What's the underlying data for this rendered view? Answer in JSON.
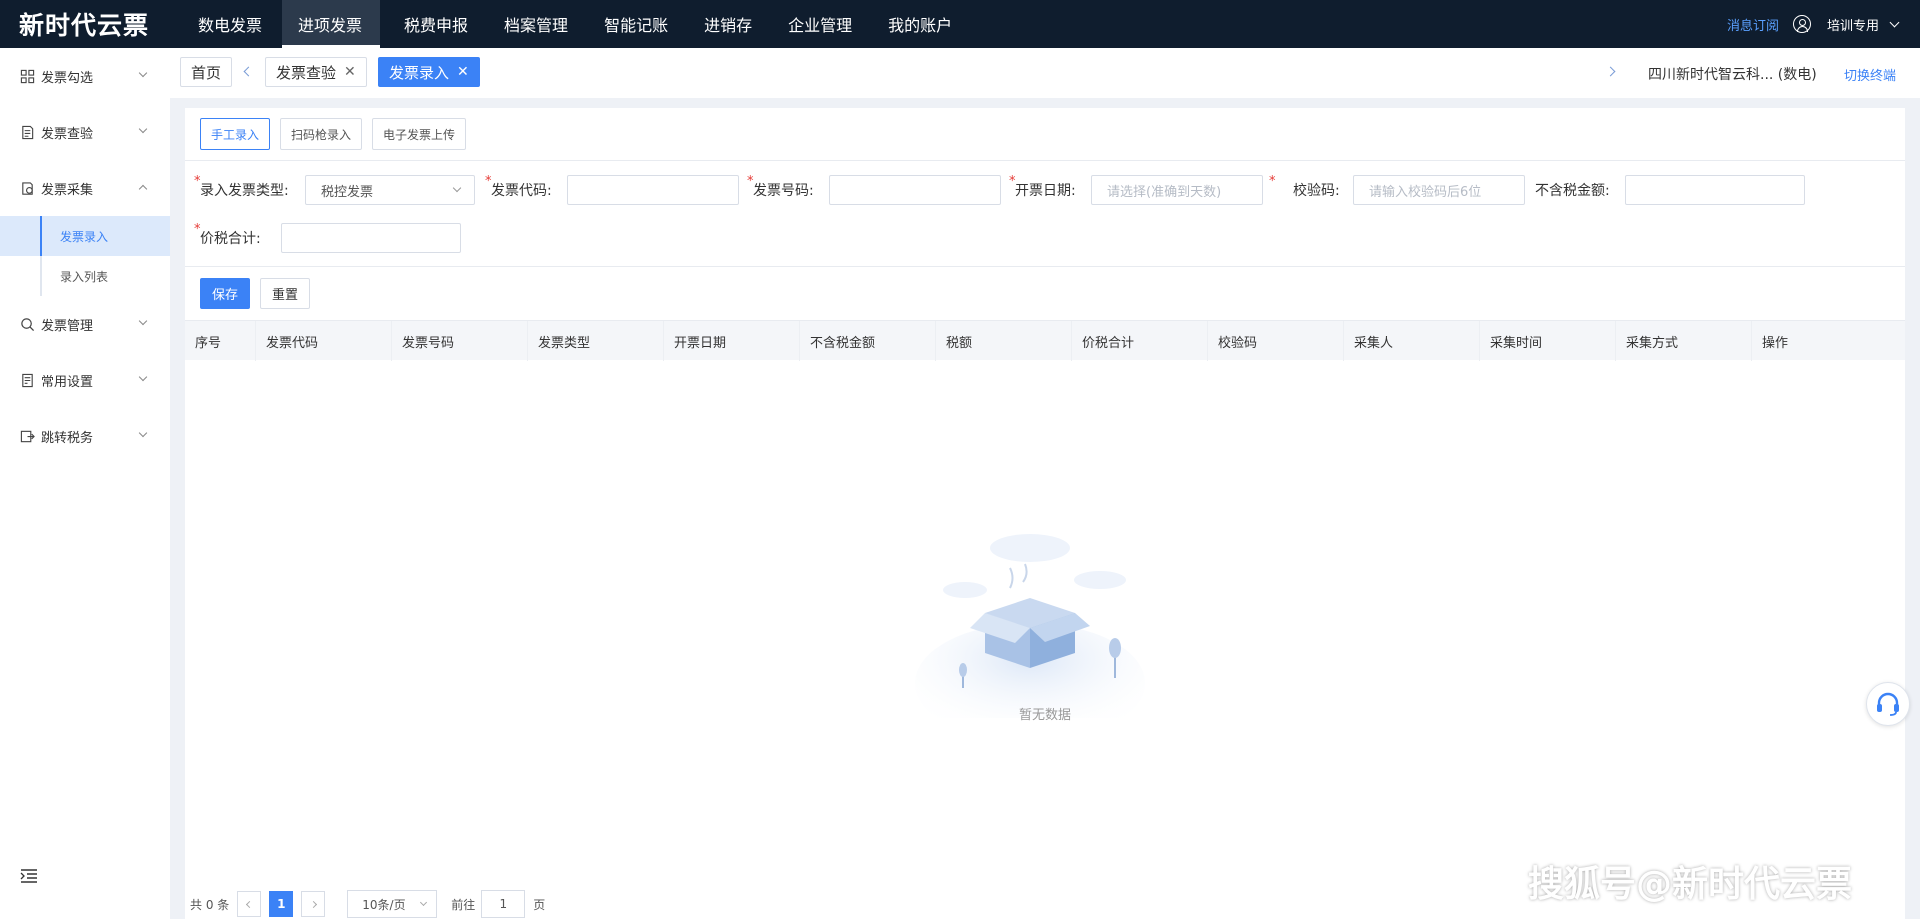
{
  "app": {
    "logo": "新时代云票",
    "nav": [
      "数电发票",
      "进项发票",
      "税费申报",
      "档案管理",
      "智能记账",
      "进销存",
      "企业管理",
      "我的账户"
    ],
    "active_nav_index": 1,
    "message_link": "消息订阅",
    "user_label": "培训专用"
  },
  "sidebar": {
    "groups": [
      {
        "label": "发票勾选",
        "icon": "grid-icon"
      },
      {
        "label": "发票查验",
        "icon": "document-check-icon"
      },
      {
        "label": "发票采集",
        "icon": "collect-icon",
        "expanded": true,
        "children": [
          {
            "label": "发票录入",
            "active": true
          },
          {
            "label": "录入列表"
          }
        ]
      },
      {
        "label": "发票管理",
        "icon": "search-icon"
      },
      {
        "label": "常用设置",
        "icon": "settings-doc-icon"
      },
      {
        "label": "跳转税务",
        "icon": "jump-icon"
      }
    ]
  },
  "tabs": {
    "items": [
      {
        "label": "首页",
        "closable": false
      },
      {
        "label": "发票查验",
        "closable": true
      },
      {
        "label": "发票录入",
        "closable": true,
        "active": true
      }
    ],
    "company": "四川新时代智云科...  (数电)",
    "switch_link": "切换终端"
  },
  "entry_modes": [
    {
      "label": "手工录入",
      "active": true
    },
    {
      "label": "扫码枪录入"
    },
    {
      "label": "电子发票上传"
    }
  ],
  "form": {
    "invoice_type_label": "录入发票类型:",
    "invoice_type_value": "税控发票",
    "code_label": "发票代码:",
    "number_label": "发票号码:",
    "date_label": "开票日期:",
    "date_placeholder": "请选择(准确到天数)",
    "check_label": "校验码:",
    "check_placeholder": "请输入校验码后6位",
    "amount_label": "不含税金额:",
    "total_label": "价税合计:",
    "save": "保存",
    "reset": "重置"
  },
  "table": {
    "columns": [
      "序号",
      "发票代码",
      "发票号码",
      "发票类型",
      "开票日期",
      "不含税金额",
      "税额",
      "价税合计",
      "校验码",
      "采集人",
      "采集时间",
      "采集方式",
      "操作"
    ],
    "rows": [],
    "empty_text": "暂无数据"
  },
  "pagination": {
    "total_text": "共 0 条",
    "current_page": "1",
    "page_size": "10条/页",
    "goto_prefix": "前往",
    "goto_value": "1",
    "goto_suffix": "页"
  },
  "watermark": "搜狐号@新时代云票",
  "colors": {
    "primary": "#3b82f6",
    "topbar": "#0f1d2e",
    "required": "#e53935"
  }
}
